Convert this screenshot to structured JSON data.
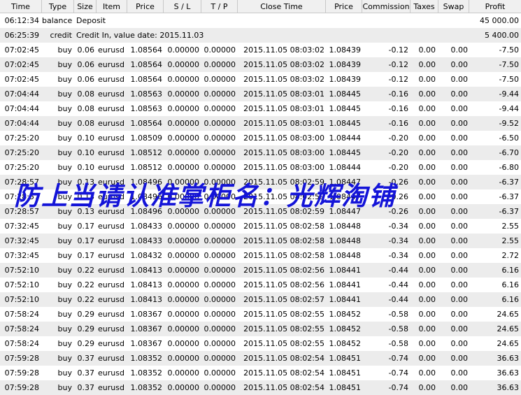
{
  "columns": [
    "Time",
    "Type",
    "Size",
    "Item",
    "Price",
    "S / L",
    "T / P",
    "Close Time",
    "Price",
    "Commission",
    "Taxes",
    "Swap",
    "Profit"
  ],
  "rows": [
    {
      "time": "06:12:34",
      "type": "balance",
      "note": "Deposit",
      "profit": "45 000.00",
      "alt": false
    },
    {
      "time": "06:25:39",
      "type": "credit",
      "note": "Credit In, value date: 2015.11.03",
      "profit": "5 400.00",
      "alt": true
    },
    {
      "time": "07:02:45",
      "type": "buy",
      "size": "0.06",
      "item": "eurusd",
      "price": "1.08564",
      "sl": "0.00000",
      "tp": "0.00000",
      "close_time": "2015.11.05 08:03:02",
      "close_price": "1.08439",
      "commission": "-0.12",
      "taxes": "0.00",
      "swap": "0.00",
      "profit": "-7.50",
      "alt": false
    },
    {
      "time": "07:02:45",
      "type": "buy",
      "size": "0.06",
      "item": "eurusd",
      "price": "1.08564",
      "sl": "0.00000",
      "tp": "0.00000",
      "close_time": "2015.11.05 08:03:02",
      "close_price": "1.08439",
      "commission": "-0.12",
      "taxes": "0.00",
      "swap": "0.00",
      "profit": "-7.50",
      "alt": true
    },
    {
      "time": "07:02:45",
      "type": "buy",
      "size": "0.06",
      "item": "eurusd",
      "price": "1.08564",
      "sl": "0.00000",
      "tp": "0.00000",
      "close_time": "2015.11.05 08:03:02",
      "close_price": "1.08439",
      "commission": "-0.12",
      "taxes": "0.00",
      "swap": "0.00",
      "profit": "-7.50",
      "alt": false
    },
    {
      "time": "07:04:44",
      "type": "buy",
      "size": "0.08",
      "item": "eurusd",
      "price": "1.08563",
      "sl": "0.00000",
      "tp": "0.00000",
      "close_time": "2015.11.05 08:03:01",
      "close_price": "1.08445",
      "commission": "-0.16",
      "taxes": "0.00",
      "swap": "0.00",
      "profit": "-9.44",
      "alt": true
    },
    {
      "time": "07:04:44",
      "type": "buy",
      "size": "0.08",
      "item": "eurusd",
      "price": "1.08563",
      "sl": "0.00000",
      "tp": "0.00000",
      "close_time": "2015.11.05 08:03:01",
      "close_price": "1.08445",
      "commission": "-0.16",
      "taxes": "0.00",
      "swap": "0.00",
      "profit": "-9.44",
      "alt": false
    },
    {
      "time": "07:04:44",
      "type": "buy",
      "size": "0.08",
      "item": "eurusd",
      "price": "1.08564",
      "sl": "0.00000",
      "tp": "0.00000",
      "close_time": "2015.11.05 08:03:01",
      "close_price": "1.08445",
      "commission": "-0.16",
      "taxes": "0.00",
      "swap": "0.00",
      "profit": "-9.52",
      "alt": true
    },
    {
      "time": "07:25:20",
      "type": "buy",
      "size": "0.10",
      "item": "eurusd",
      "price": "1.08509",
      "sl": "0.00000",
      "tp": "0.00000",
      "close_time": "2015.11.05 08:03:00",
      "close_price": "1.08444",
      "commission": "-0.20",
      "taxes": "0.00",
      "swap": "0.00",
      "profit": "-6.50",
      "alt": false
    },
    {
      "time": "07:25:20",
      "type": "buy",
      "size": "0.10",
      "item": "eurusd",
      "price": "1.08512",
      "sl": "0.00000",
      "tp": "0.00000",
      "close_time": "2015.11.05 08:03:00",
      "close_price": "1.08445",
      "commission": "-0.20",
      "taxes": "0.00",
      "swap": "0.00",
      "profit": "-6.70",
      "alt": true
    },
    {
      "time": "07:25:20",
      "type": "buy",
      "size": "0.10",
      "item": "eurusd",
      "price": "1.08512",
      "sl": "0.00000",
      "tp": "0.00000",
      "close_time": "2015.11.05 08:03:00",
      "close_price": "1.08444",
      "commission": "-0.20",
      "taxes": "0.00",
      "swap": "0.00",
      "profit": "-6.80",
      "alt": false
    },
    {
      "time": "07:28:57",
      "type": "buy",
      "size": "0.13",
      "item": "eurusd",
      "price": "1.08496",
      "sl": "0.00000",
      "tp": "0.00000",
      "close_time": "2015.11.05 08:02:59",
      "close_price": "1.08447",
      "commission": "-0.26",
      "taxes": "0.00",
      "swap": "0.00",
      "profit": "-6.37",
      "alt": true
    },
    {
      "time": "07:28:57",
      "type": "buy",
      "size": "0.13",
      "item": "eurusd",
      "price": "1.08496",
      "sl": "0.00000",
      "tp": "0.00000",
      "close_time": "2015.11.05 08:02:59",
      "close_price": "1.08447",
      "commission": "-0.26",
      "taxes": "0.00",
      "swap": "0.00",
      "profit": "-6.37",
      "alt": false
    },
    {
      "time": "07:28:57",
      "type": "buy",
      "size": "0.13",
      "item": "eurusd",
      "price": "1.08496",
      "sl": "0.00000",
      "tp": "0.00000",
      "close_time": "2015.11.05 08:02:59",
      "close_price": "1.08447",
      "commission": "-0.26",
      "taxes": "0.00",
      "swap": "0.00",
      "profit": "-6.37",
      "alt": true
    },
    {
      "time": "07:32:45",
      "type": "buy",
      "size": "0.17",
      "item": "eurusd",
      "price": "1.08433",
      "sl": "0.00000",
      "tp": "0.00000",
      "close_time": "2015.11.05 08:02:58",
      "close_price": "1.08448",
      "commission": "-0.34",
      "taxes": "0.00",
      "swap": "0.00",
      "profit": "2.55",
      "alt": false
    },
    {
      "time": "07:32:45",
      "type": "buy",
      "size": "0.17",
      "item": "eurusd",
      "price": "1.08433",
      "sl": "0.00000",
      "tp": "0.00000",
      "close_time": "2015.11.05 08:02:58",
      "close_price": "1.08448",
      "commission": "-0.34",
      "taxes": "0.00",
      "swap": "0.00",
      "profit": "2.55",
      "alt": true
    },
    {
      "time": "07:32:45",
      "type": "buy",
      "size": "0.17",
      "item": "eurusd",
      "price": "1.08432",
      "sl": "0.00000",
      "tp": "0.00000",
      "close_time": "2015.11.05 08:02:58",
      "close_price": "1.08448",
      "commission": "-0.34",
      "taxes": "0.00",
      "swap": "0.00",
      "profit": "2.72",
      "alt": false
    },
    {
      "time": "07:52:10",
      "type": "buy",
      "size": "0.22",
      "item": "eurusd",
      "price": "1.08413",
      "sl": "0.00000",
      "tp": "0.00000",
      "close_time": "2015.11.05 08:02:56",
      "close_price": "1.08441",
      "commission": "-0.44",
      "taxes": "0.00",
      "swap": "0.00",
      "profit": "6.16",
      "alt": true
    },
    {
      "time": "07:52:10",
      "type": "buy",
      "size": "0.22",
      "item": "eurusd",
      "price": "1.08413",
      "sl": "0.00000",
      "tp": "0.00000",
      "close_time": "2015.11.05 08:02:56",
      "close_price": "1.08441",
      "commission": "-0.44",
      "taxes": "0.00",
      "swap": "0.00",
      "profit": "6.16",
      "alt": false
    },
    {
      "time": "07:52:10",
      "type": "buy",
      "size": "0.22",
      "item": "eurusd",
      "price": "1.08413",
      "sl": "0.00000",
      "tp": "0.00000",
      "close_time": "2015.11.05 08:02:57",
      "close_price": "1.08441",
      "commission": "-0.44",
      "taxes": "0.00",
      "swap": "0.00",
      "profit": "6.16",
      "alt": true
    },
    {
      "time": "07:58:24",
      "type": "buy",
      "size": "0.29",
      "item": "eurusd",
      "price": "1.08367",
      "sl": "0.00000",
      "tp": "0.00000",
      "close_time": "2015.11.05 08:02:55",
      "close_price": "1.08452",
      "commission": "-0.58",
      "taxes": "0.00",
      "swap": "0.00",
      "profit": "24.65",
      "alt": false
    },
    {
      "time": "07:58:24",
      "type": "buy",
      "size": "0.29",
      "item": "eurusd",
      "price": "1.08367",
      "sl": "0.00000",
      "tp": "0.00000",
      "close_time": "2015.11.05 08:02:55",
      "close_price": "1.08452",
      "commission": "-0.58",
      "taxes": "0.00",
      "swap": "0.00",
      "profit": "24.65",
      "alt": true
    },
    {
      "time": "07:58:24",
      "type": "buy",
      "size": "0.29",
      "item": "eurusd",
      "price": "1.08367",
      "sl": "0.00000",
      "tp": "0.00000",
      "close_time": "2015.11.05 08:02:55",
      "close_price": "1.08452",
      "commission": "-0.58",
      "taxes": "0.00",
      "swap": "0.00",
      "profit": "24.65",
      "alt": false
    },
    {
      "time": "07:59:28",
      "type": "buy",
      "size": "0.37",
      "item": "eurusd",
      "price": "1.08352",
      "sl": "0.00000",
      "tp": "0.00000",
      "close_time": "2015.11.05 08:02:54",
      "close_price": "1.08451",
      "commission": "-0.74",
      "taxes": "0.00",
      "swap": "0.00",
      "profit": "36.63",
      "alt": true
    },
    {
      "time": "07:59:28",
      "type": "buy",
      "size": "0.37",
      "item": "eurusd",
      "price": "1.08352",
      "sl": "0.00000",
      "tp": "0.00000",
      "close_time": "2015.11.05 08:02:54",
      "close_price": "1.08451",
      "commission": "-0.74",
      "taxes": "0.00",
      "swap": "0.00",
      "profit": "36.63",
      "alt": false
    },
    {
      "time": "07:59:28",
      "type": "buy",
      "size": "0.37",
      "item": "eurusd",
      "price": "1.08352",
      "sl": "0.00000",
      "tp": "0.00000",
      "close_time": "2015.11.05 08:02:54",
      "close_price": "1.08451",
      "commission": "-0.74",
      "taxes": "0.00",
      "swap": "0.00",
      "profit": "36.63",
      "alt": true
    }
  ],
  "watermark": "防上当请认准掌柜名：光辉淘铺",
  "colors": {
    "header_bg": "#f0f0f0",
    "alt_row_bg": "#ececec",
    "watermark": "#1414d8"
  }
}
